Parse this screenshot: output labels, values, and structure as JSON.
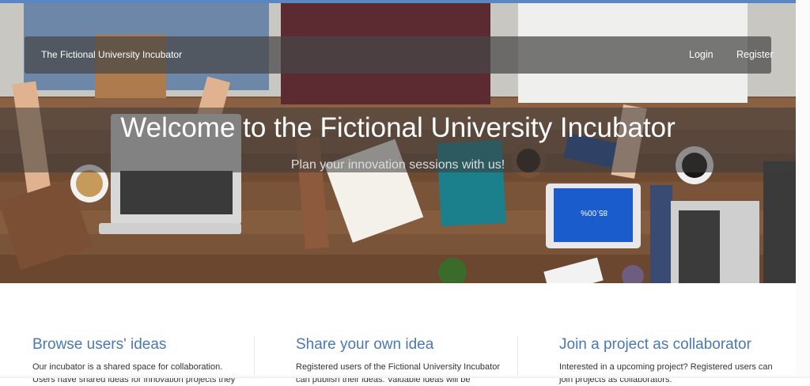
{
  "navbar": {
    "brand": "The Fictional University Incubator",
    "links": [
      {
        "label": "Login"
      },
      {
        "label": "Register"
      }
    ]
  },
  "hero": {
    "title": "Welcome to the Fictional University Incubator",
    "subtitle": "Plan your innovation sessions with us!",
    "image_description_text": "85.00%"
  },
  "features": [
    {
      "title": "Browse users' ideas",
      "text": "Our incubator is a shared space for collaboration. Users have shared ideas for innovation projects they"
    },
    {
      "title": "Share your own idea",
      "text": "Registered users of the Fictional University Incubator can publish their ideas. Valuable ideas will be"
    },
    {
      "title": "Join a project as collaborator",
      "text": "Interested in a upcoming project? Registered users can join projects as collaborators."
    }
  ],
  "colors": {
    "accent": "#5b86c4",
    "feature_title": "#4a78b7"
  }
}
